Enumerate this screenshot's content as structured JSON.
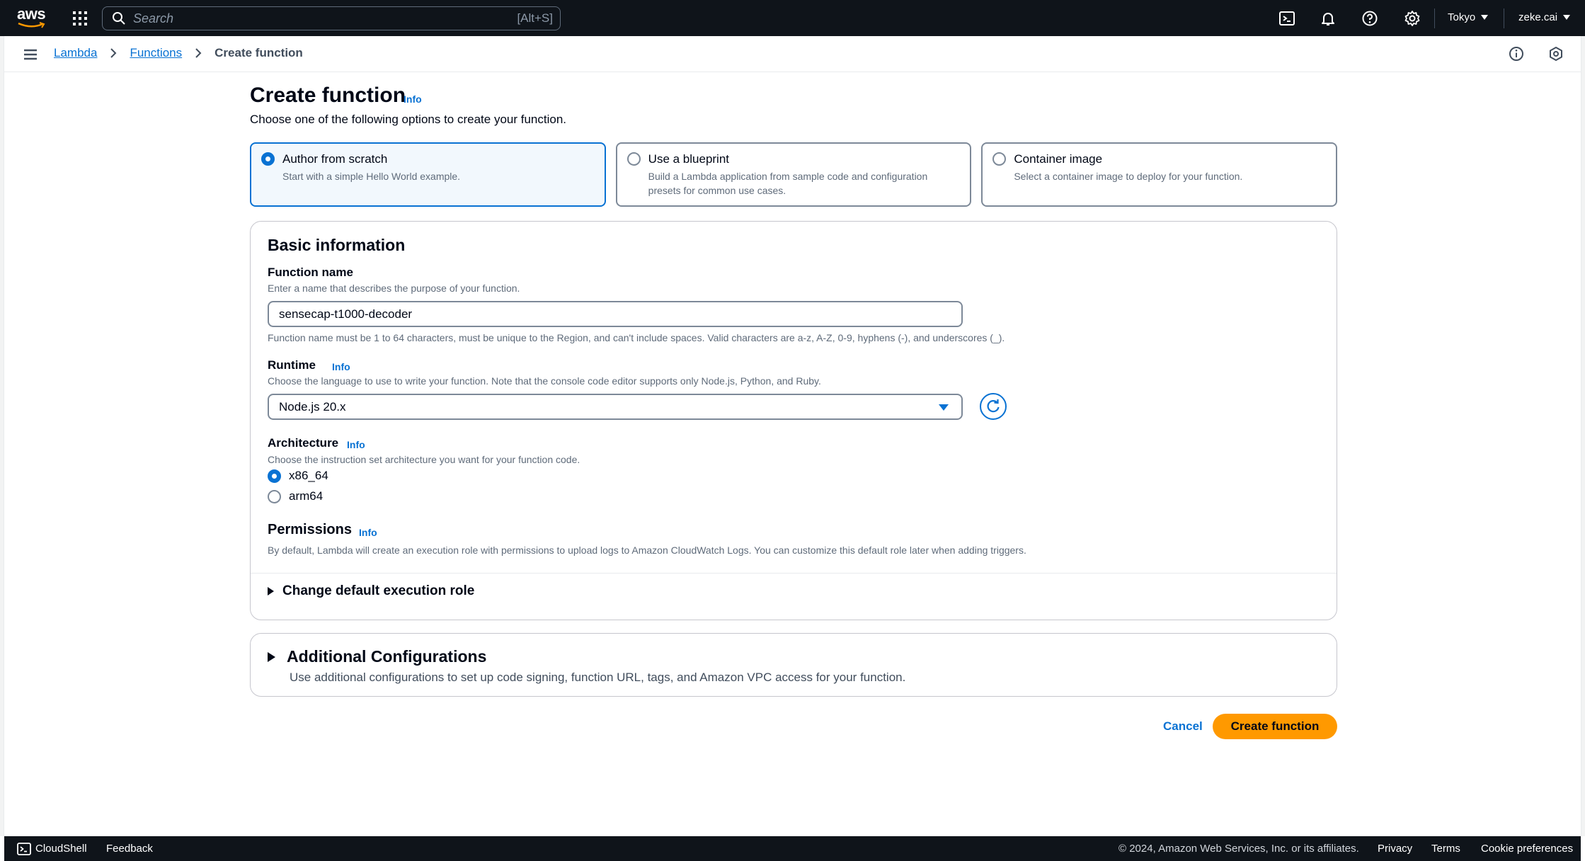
{
  "topnav": {
    "logo_text": "aws",
    "search_placeholder": "Search",
    "search_shortcut": "[Alt+S]",
    "region": "Tokyo",
    "user": "zeke.cai"
  },
  "breadcrumb": {
    "items": [
      "Lambda",
      "Functions"
    ],
    "current": "Create function"
  },
  "page": {
    "title": "Create function",
    "info": "Info",
    "description": "Choose one of the following options to create your function."
  },
  "options": [
    {
      "label": "Author from scratch",
      "desc": "Start with a simple Hello World example.",
      "selected": true
    },
    {
      "label": "Use a blueprint",
      "desc": "Build a Lambda application from sample code and configuration presets for common use cases.",
      "selected": false
    },
    {
      "label": "Container image",
      "desc": "Select a container image to deploy for your function.",
      "selected": false
    }
  ],
  "basic": {
    "heading": "Basic information",
    "function_name": {
      "label": "Function name",
      "desc": "Enter a name that describes the purpose of your function.",
      "value": "sensecap-t1000-decoder",
      "constraint": "Function name must be 1 to 64 characters, must be unique to the Region, and can't include spaces. Valid characters are a-z, A-Z, 0-9, hyphens (-), and underscores (_)."
    },
    "runtime": {
      "label": "Runtime",
      "info": "Info",
      "desc": "Choose the language to use to write your function. Note that the console code editor supports only Node.js, Python, and Ruby.",
      "value": "Node.js 20.x"
    },
    "architecture": {
      "label": "Architecture",
      "info": "Info",
      "desc": "Choose the instruction set architecture you want for your function code.",
      "options": [
        "x86_64",
        "arm64"
      ],
      "selected": "x86_64"
    },
    "permissions": {
      "label": "Permissions",
      "info": "Info",
      "desc": "By default, Lambda will create an execution role with permissions to upload logs to Amazon CloudWatch Logs. You can customize this default role later when adding triggers.",
      "expander": "Change default execution role"
    }
  },
  "additional": {
    "heading": "Additional Configurations",
    "desc": "Use additional configurations to set up code signing, function URL, tags, and Amazon VPC access for your function."
  },
  "actions": {
    "cancel": "Cancel",
    "create": "Create function"
  },
  "footer": {
    "cloudshell": "CloudShell",
    "feedback": "Feedback",
    "copyright": "© 2024, Amazon Web Services, Inc. or its affiliates.",
    "privacy": "Privacy",
    "terms": "Terms",
    "cookies": "Cookie preferences"
  },
  "colors": {
    "nav_bg": "#0f141a",
    "link": "#0972d3",
    "primary_button": "#ff9900",
    "selected_tile_bg": "#f2f8fd"
  },
  "icons": [
    "aws-logo",
    "grid-icon",
    "search-icon",
    "cloudshell-icon",
    "bell-icon",
    "help-icon",
    "gear-icon",
    "hamburger-icon",
    "chevron-right-icon",
    "info-circle-icon",
    "hexagon-icon",
    "refresh-icon",
    "caret-down-icon",
    "caret-right-icon"
  ]
}
